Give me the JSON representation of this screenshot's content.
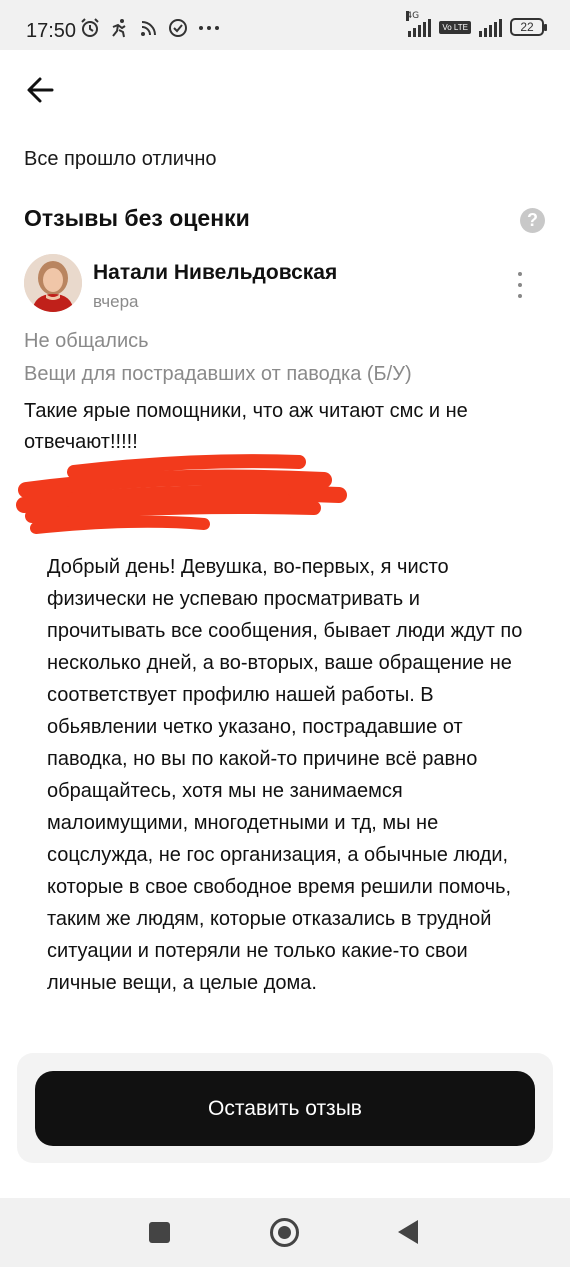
{
  "status_bar": {
    "time": "17:50",
    "network_tag": "4G",
    "volte_label": "Vo LTE",
    "battery": "22"
  },
  "previous_review": {
    "text": "Все прошло отлично"
  },
  "section": {
    "title": "Отзывы без оценки",
    "help_icon": "question-icon"
  },
  "review": {
    "author": "Натали Нивельдовская",
    "date": "вчера",
    "deal_status": "Не общались",
    "item": "Вещи для пострадавших от паводка (Б/У)",
    "text": "Такие ярые помощники, что аж читают смс и не отвечают!!!!!"
  },
  "reply": {
    "text": "Добрый день! Девушка, во-первых, я чисто физически не успеваю просматривать и прочитывать все сообщения, бывает люди ждут по несколько дней, а во-вторых, ваше обращение не соответствует профилю нашей работы. В обьявлении четко указано, пострадавшие от паводка, но вы по какой-то причине всё равно обращайтесь, хотя мы не занимаемся малоимущими, многодетными и тд, мы не соцслужда, не гос организация, а обычные люди, которые в свое свободное время решили помочь, таким же людям, которые отказались в трудной ситуации и потеряли не только какие-то свои личные вещи, а целые дома."
  },
  "cta": {
    "label": "Оставить отзыв"
  },
  "colors": {
    "redaction": "#f23a1c",
    "button": "#111111",
    "muted_text": "#8a8a8a"
  }
}
